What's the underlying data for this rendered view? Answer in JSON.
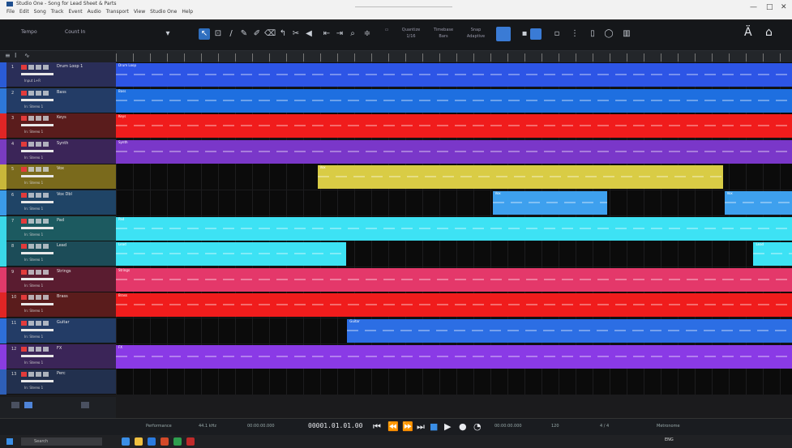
{
  "window": {
    "title": "Studio One - Song for Lead Sheet & Parts",
    "menu": [
      "File",
      "Edit",
      "Song",
      "Track",
      "Event",
      "Audio",
      "Transport",
      "View",
      "Studio One",
      "Help"
    ]
  },
  "toolbar": {
    "left_key": "Tempo",
    "left_value": "Count In",
    "quantize_label": "Quantize",
    "quantize_value": "1/16",
    "timebase_label": "Timebase",
    "timebase_value": "Bars",
    "snap_label": "Snap",
    "snap_value": "Adaptive"
  },
  "header_tools": [
    "≡",
    "I",
    "∿"
  ],
  "tracks": [
    {
      "num": "1",
      "name": "Drum Loop 1",
      "lane_color": "#2a5bd6",
      "head_bg": "#2a2e58",
      "sub": "Input L+R",
      "clips": [
        {
          "start": 0.0,
          "end": 1.0,
          "color": "#2d55e6",
          "label": "Drum Loop"
        }
      ]
    },
    {
      "num": "2",
      "name": "Bass",
      "lane_color": "#2e78d8",
      "head_bg": "#233c66",
      "sub": "In: Stereo 1",
      "clips": [
        {
          "start": 0.0,
          "end": 1.0,
          "color": "#1e6fe0",
          "label": "Bass"
        }
      ]
    },
    {
      "num": "3",
      "name": "Keys",
      "lane_color": "#e02525",
      "head_bg": "#5a1c1c",
      "sub": "In: Stereo 1",
      "clips": [
        {
          "start": 0.0,
          "end": 1.0,
          "color": "#f01c1c",
          "label": "Keys"
        }
      ]
    },
    {
      "num": "4",
      "name": "Synth",
      "lane_color": "#7a3cc0",
      "head_bg": "#3b2558",
      "sub": "In: Stereo 1",
      "clips": [
        {
          "start": 0.0,
          "end": 1.0,
          "color": "#7a37c9",
          "label": "Synth"
        }
      ]
    },
    {
      "num": "5",
      "name": "Vox",
      "lane_color": "#c9b73a",
      "head_bg": "#7a6a1c",
      "sub": "In: Stereo 1",
      "clips": [
        {
          "start": 0.298,
          "end": 0.898,
          "color": "#d9cc45",
          "label": "Vox"
        }
      ]
    },
    {
      "num": "6",
      "name": "Vox Dbl",
      "lane_color": "#3b9be8",
      "head_bg": "#1f4466",
      "sub": "In: Stereo 1",
      "clips": [
        {
          "start": 0.557,
          "end": 0.727,
          "color": "#3ea0ee",
          "label": "Vox"
        },
        {
          "start": 0.9,
          "end": 1.0,
          "color": "#3ea0ee",
          "label": "Vox"
        }
      ]
    },
    {
      "num": "7",
      "name": "Pad",
      "lane_color": "#3ad8e8",
      "head_bg": "#1c5a60",
      "sub": "In: Stereo 1",
      "clips": [
        {
          "start": 0.0,
          "end": 1.0,
          "color": "#3de2f4",
          "label": "Pad"
        }
      ]
    },
    {
      "num": "8",
      "name": "Lead",
      "lane_color": "#3ad8e8",
      "head_bg": "#1c4c58",
      "sub": "In: Stereo 1",
      "clips": [
        {
          "start": 0.0,
          "end": 0.34,
          "color": "#3de2f4",
          "label": "Lead"
        },
        {
          "start": 0.943,
          "end": 1.0,
          "color": "#3de2f4",
          "label": "Lead"
        }
      ]
    },
    {
      "num": "9",
      "name": "Strings",
      "lane_color": "#e03a6a",
      "head_bg": "#5a1c30",
      "sub": "In: Stereo 1",
      "clips": [
        {
          "start": 0.0,
          "end": 1.0,
          "color": "#e4386a",
          "label": "Strings"
        }
      ]
    },
    {
      "num": "10",
      "name": "Brass",
      "lane_color": "#e02525",
      "head_bg": "#5a1c1c",
      "sub": "In: Stereo 1",
      "clips": [
        {
          "start": 0.0,
          "end": 1.0,
          "color": "#f01c1c",
          "label": "Brass"
        }
      ]
    },
    {
      "num": "11",
      "name": "Guitar",
      "lane_color": "#2e6fd8",
      "head_bg": "#233c66",
      "sub": "In: Stereo 1",
      "clips": [
        {
          "start": 0.342,
          "end": 1.0,
          "color": "#2c6ee4",
          "label": "Guitar"
        }
      ]
    },
    {
      "num": "12",
      "name": "FX",
      "lane_color": "#8a3ce0",
      "head_bg": "#3b2558",
      "sub": "In: Stereo 1",
      "clips": [
        {
          "start": 0.0,
          "end": 1.0,
          "color": "#8a3ae6",
          "label": "FX"
        }
      ]
    },
    {
      "num": "13",
      "name": "Perc",
      "lane_color": "#2e5fb8",
      "head_bg": "#22304e",
      "sub": "In: Stereo 1",
      "clips": []
    }
  ],
  "transport": {
    "time": "00001.01.01.00",
    "left_labels": [
      "Performance",
      "44.1 kHz",
      "00:00:00.000"
    ],
    "right_labels": [
      "120",
      "4 / 4",
      "Metronome",
      "00:00:00.000"
    ]
  },
  "taskbar": {
    "search_placeholder": "Search",
    "tray_text": "ENG"
  }
}
